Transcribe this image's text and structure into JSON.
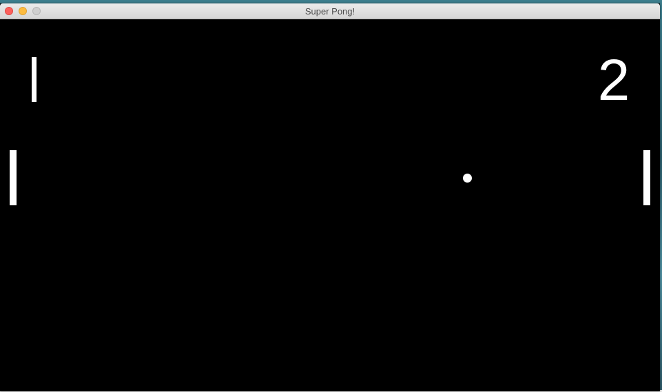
{
  "window": {
    "title": "Super Pong!"
  },
  "scoreboard": {
    "left_score": "1",
    "right_score": "2"
  },
  "colors": {
    "field": "#000000",
    "foreground": "#ffffff"
  }
}
